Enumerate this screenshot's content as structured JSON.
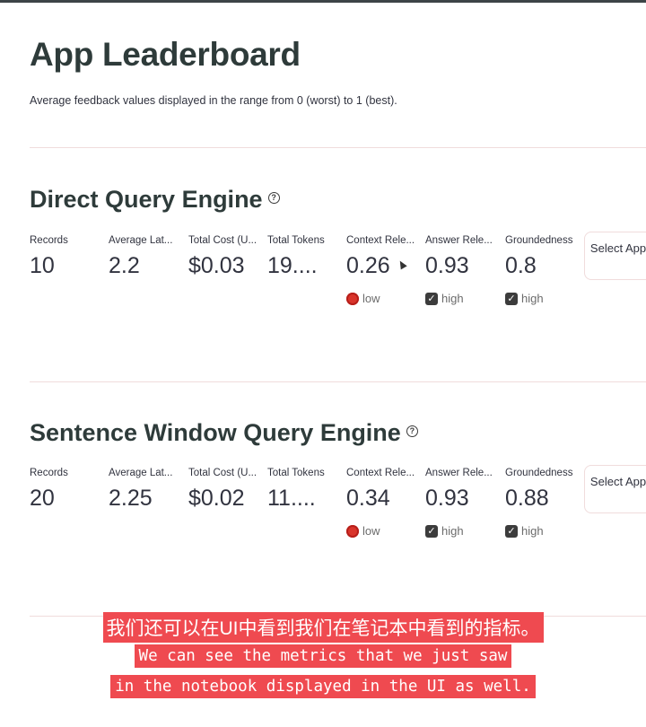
{
  "page": {
    "title": "App Leaderboard",
    "subtitle": "Average feedback values displayed in the range from 0 (worst) to 1 (best)."
  },
  "apps": [
    {
      "name": "Direct Query Engine",
      "metrics": [
        {
          "label": "Records",
          "value": "10"
        },
        {
          "label": "Average Lat...",
          "value": "2.2"
        },
        {
          "label": "Total Cost (U...",
          "value": "$0.03"
        },
        {
          "label": "Total Tokens",
          "value": "19...."
        },
        {
          "label": "Context Rele...",
          "value": "0.26"
        },
        {
          "label": "Answer Rele...",
          "value": "0.93"
        },
        {
          "label": "Groundedness",
          "value": "0.8"
        }
      ],
      "badges": [
        "low",
        "high",
        "high"
      ],
      "select_label": "Select App"
    },
    {
      "name": "Sentence Window Query Engine",
      "metrics": [
        {
          "label": "Records",
          "value": "20"
        },
        {
          "label": "Average Lat...",
          "value": "2.25"
        },
        {
          "label": "Total Cost (U...",
          "value": "$0.02"
        },
        {
          "label": "Total Tokens",
          "value": "11...."
        },
        {
          "label": "Context Rele...",
          "value": "0.34"
        },
        {
          "label": "Answer Rele...",
          "value": "0.93"
        },
        {
          "label": "Groundedness",
          "value": "0.88"
        }
      ],
      "badges": [
        "low",
        "high",
        "high"
      ],
      "select_label": "Select App"
    }
  ],
  "captions": {
    "zh": "我们还可以在UI中看到我们在笔记本中看到的指标。",
    "en_line1": "We can see the metrics that we just saw",
    "en_line2": "in the notebook displayed in the UI as well."
  },
  "colors": {
    "badge_low": "#d9342b",
    "badge_high": "#3c3c3c",
    "caption_bg": "#ef4a50"
  },
  "icons": {
    "help": "question-circle-icon",
    "low": "red-circle-icon",
    "high": "check-box-icon",
    "cursor": "mouse-cursor-icon"
  }
}
